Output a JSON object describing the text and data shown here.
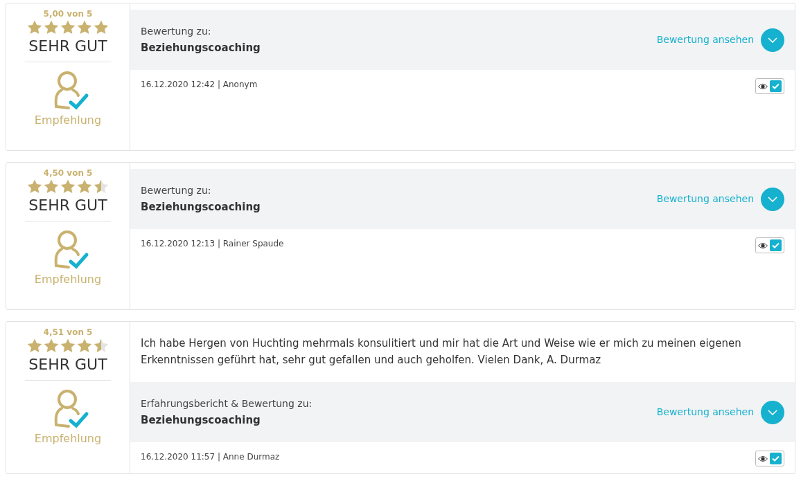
{
  "reviews": [
    {
      "score": "5,00 von 5",
      "stars": 5,
      "verdict": "SEHR GUT",
      "recommendation": "Empfehlung",
      "subject_label": "Bewertung zu:",
      "subject": "Beziehungscoaching",
      "link": "Bewertung ansehen",
      "meta": "16.12.2020 12:42 | Anonym",
      "checked": true
    },
    {
      "score": "4,50 von 5",
      "stars": 4.5,
      "verdict": "SEHR GUT",
      "recommendation": "Empfehlung",
      "subject_label": "Bewertung zu:",
      "subject": "Beziehungscoaching",
      "link": "Bewertung ansehen",
      "meta": "16.12.2020 12:13 | Rainer Spaude",
      "checked": true
    },
    {
      "score": "4,51 von 5",
      "stars": 4.5,
      "verdict": "SEHR GUT",
      "recommendation": "Empfehlung",
      "text": "Ich habe Hergen von Huchting mehrmals konsulitiert und mir hat die Art und Weise wie er mich zu meinen eigenen Erkenntnissen geführt hat, sehr gut gefallen und auch geholfen. Vielen Dank, A. Durmaz",
      "subject_label": "Erfahrungsbericht & Bewertung zu:",
      "subject": "Beziehungscoaching",
      "link": "Bewertung ansehen",
      "meta": "16.12.2020 11:57 | Anne Durmaz",
      "checked": true
    }
  ]
}
